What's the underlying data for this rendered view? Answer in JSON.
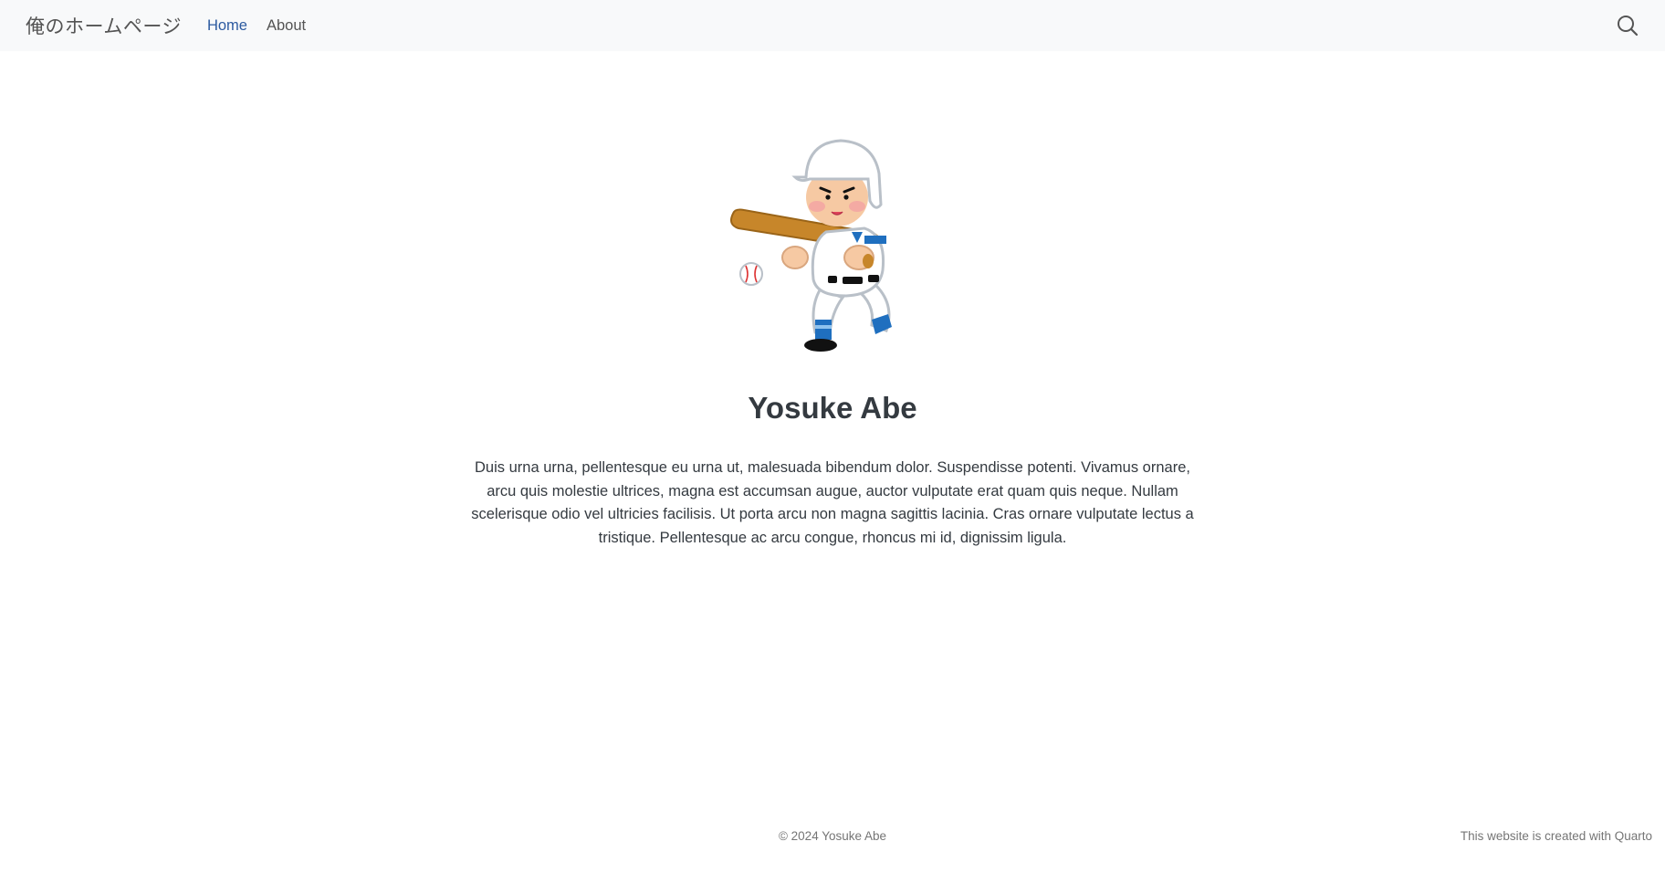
{
  "navbar": {
    "brand": "俺のホームページ",
    "links": [
      {
        "label": "Home",
        "active": true
      },
      {
        "label": "About",
        "active": false
      }
    ],
    "search_icon": "search-icon"
  },
  "profile": {
    "image": "baseball-batter-illustration",
    "name": "Yosuke Abe",
    "bio": "Duis urna urna, pellentesque eu urna ut, malesuada bibendum dolor. Suspendisse potenti. Vivamus ornare, arcu quis molestie ultrices, magna est accumsan augue, auctor vulputate erat quam quis neque. Nullam scelerisque odio vel ultricies facilisis. Ut porta arcu non magna sagittis lacinia. Cras ornare vulputate lectus a tristique. Pellentesque ac arcu congue, rhoncus mi id, dignissim ligula."
  },
  "footer": {
    "copyright": "© 2024 Yosuke Abe",
    "credit": "This website is created with Quarto"
  },
  "colors": {
    "navbar_bg": "#f8f9fa",
    "active_link": "#2c5aa0",
    "text": "#343a40"
  }
}
